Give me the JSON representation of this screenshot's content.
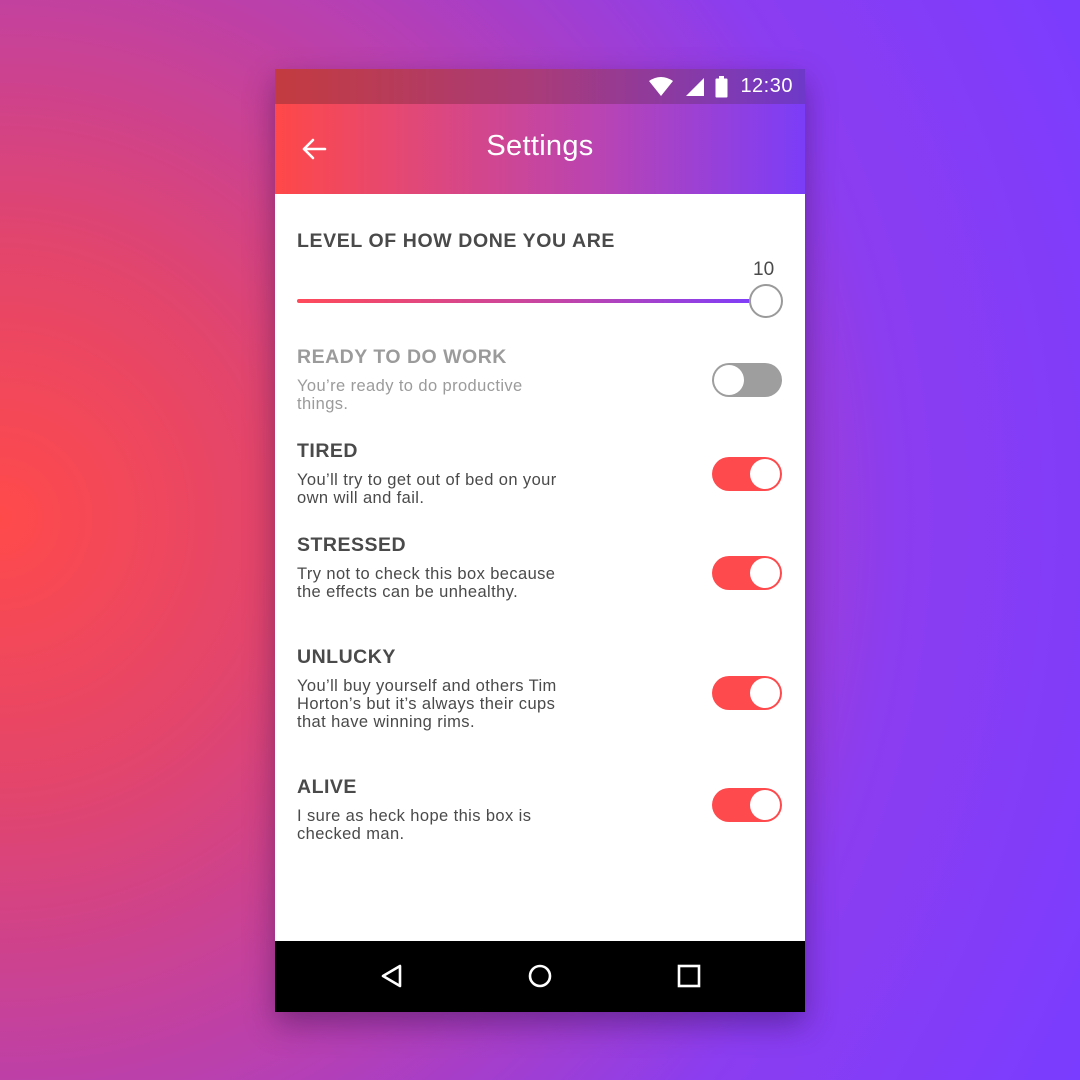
{
  "status_bar": {
    "time": "12:30",
    "icons": [
      "wifi-icon",
      "signal-icon",
      "battery-icon"
    ]
  },
  "app_bar": {
    "title": "Settings",
    "back_icon": "arrow-back-icon"
  },
  "slider": {
    "title": "LEVEL OF HOW DONE YOU ARE",
    "value": "10",
    "fraction": 1.0
  },
  "settings": [
    {
      "title": "READY TO DO WORK",
      "description": "You’re ready to do productive things.",
      "enabled": false,
      "row_disabled": true
    },
    {
      "title": "TIRED",
      "description": "You’ll try to get out of bed on your own will and fail.",
      "enabled": true
    },
    {
      "title": "STRESSED",
      "description": "Try not to check this box because the effects can be unhealthy.",
      "enabled": true
    },
    {
      "title": "UNLUCKY",
      "description": "You’ll buy yourself and others Tim Horton’s but it’s always their cups that have winning rims.",
      "enabled": true
    },
    {
      "title": "ALIVE",
      "description": "I sure as heck hope this box is checked man.",
      "enabled": true
    }
  ],
  "nav_bar": {
    "icons": [
      "nav-back-icon",
      "nav-home-icon",
      "nav-recents-icon"
    ]
  },
  "colors": {
    "toggle_on": "#ff4a4d",
    "toggle_off": "#9e9e9e",
    "text_primary": "#4a4a4a",
    "text_disabled": "#9b9b9b",
    "accent_start": "#ff4848",
    "accent_end": "#7b3df8"
  }
}
